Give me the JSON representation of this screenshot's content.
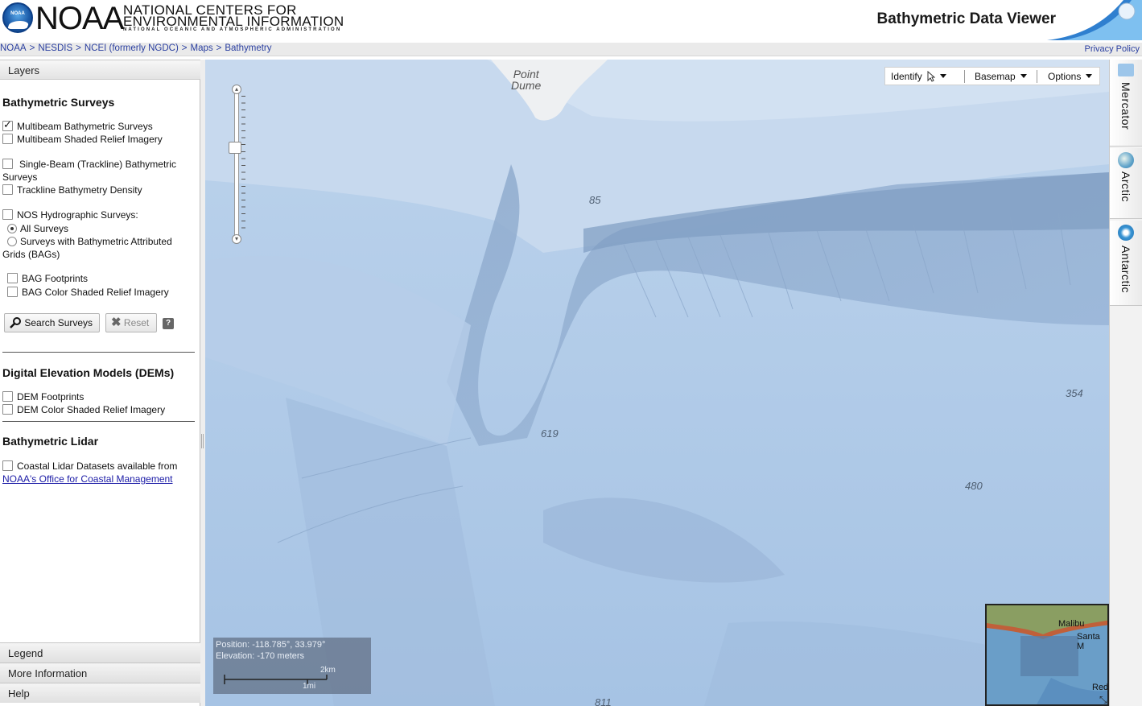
{
  "header": {
    "logo_text": "NOAA",
    "logo_badge": "NOAA",
    "ncei_line1": "NATIONAL CENTERS FOR",
    "ncei_line2": "ENVIRONMENTAL INFORMATION",
    "ncei_line3": "NATIONAL OCEANIC AND ATMOSPHERIC ADMINISTRATION",
    "app_title": "Bathymetric Data Viewer"
  },
  "breadcrumb": [
    "NOAA",
    "NESDIS",
    "NCEI (formerly NGDC)",
    "Maps",
    "Bathymetry"
  ],
  "breadcrumb_sep": ">",
  "privacy_label": "Privacy Policy",
  "left_panel": {
    "header": "Layers",
    "bathymetric_surveys": {
      "title": "Bathymetric Surveys",
      "multibeam": "Multibeam Bathymetric Surveys",
      "multibeam_checked": true,
      "multibeam_relief": "Multibeam Shaded Relief Imagery",
      "singlebeam": "Single-Beam (Trackline) Bathymetric Surveys",
      "trackline_density": "Trackline Bathymetry Density",
      "nos": "NOS Hydrographic Surveys:",
      "all_surveys": "All Surveys",
      "bag_surveys": "Surveys with Bathymetric Attributed Grids (BAGs)",
      "bag_footprints": "BAG Footprints",
      "bag_relief": "BAG Color Shaded Relief Imagery",
      "search_button": "Search Surveys",
      "reset_button": "Reset",
      "help_button": "?"
    },
    "dems": {
      "title": "Digital Elevation Models (DEMs)",
      "footprints": "DEM Footprints",
      "relief": "DEM Color Shaded Relief Imagery"
    },
    "lidar": {
      "title": "Bathymetric Lidar",
      "text": "Coastal Lidar Datasets available from",
      "link": "NOAA's Office for Coastal Management"
    },
    "accordion": [
      "Legend",
      "More Information",
      "Help"
    ]
  },
  "map": {
    "toolbar": {
      "identify": "Identify",
      "basemap": "Basemap",
      "options": "Options"
    },
    "place_label_1": "Point",
    "place_label_2": "Dume",
    "depth_labels": [
      "85",
      "619",
      "354",
      "480",
      "811"
    ],
    "position_text": "Position: -118.785°, 33.979°",
    "elevation_text": "Elevation: -170 meters",
    "scale_km": "2km",
    "scale_mi": "1mi",
    "overview": {
      "label_malibu": "Malibu",
      "label_santa": "Santa M",
      "label_red": "Red"
    }
  },
  "projections": [
    "Mercator",
    "Arctic",
    "Antarctic"
  ],
  "colors": {
    "map_water": "#a9c6e6",
    "link": "#2a3fa0",
    "noaa_blue": "#1b5aa8"
  }
}
